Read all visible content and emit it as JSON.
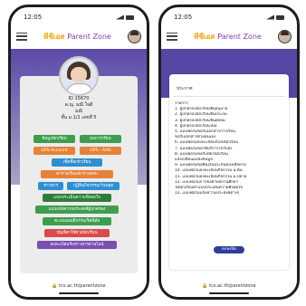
{
  "time_left": "12:05",
  "time_right": "12:05",
  "brand": {
    "logo": "ทีซีเอส",
    "title": "Parent Zone"
  },
  "profile": {
    "id_line": "ID 15670",
    "name": "ด.ญ. มณี ใจดี",
    "nickname": "มณี",
    "class": "ชั้น ม.1/1 เลขที่ 5"
  },
  "menu": {
    "btn1": "ข้อมูลนักเรียน",
    "btn2": "ผลการเรียน",
    "btn3": "GPS Account",
    "btn4": "GPS - AAA",
    "btn5": "เช็คชื่อเข้าเรียน",
    "btn6": "ตารางเรียน/ตารางสอบ",
    "btn7": "ข่าวสาร",
    "btn8": "ปฏิทินกิจกรรม/วันหยุด",
    "btn9": "แบบประเมินความพึงพอใจ",
    "btn10": "แบบแจ้งความประสงค์ผู้ปกครอง",
    "btn11": "คะแนนพฤติกรรม/จิตพิสัย",
    "btn12": "บัญชีค่าใช้จ่ายนักเรียน",
    "btn13": "ลงทะเบียนรับข่าวสารผ่านไลน์"
  },
  "footer_left": "🔒 tcs.ac.th/parentzone",
  "footer_right": "🔒 tcs.ac.th/parentzone",
  "dialog": {
    "title": "ประกาศ",
    "list_heading": "รายการ",
    "items": [
      "1. ผู้ปกครองนักเรียนชั้นอนุบาล",
      "2. ผู้ปกครองนักเรียนชั้นประถม",
      "3. ผู้ปกครองนักเรียนชั้นมัธยม",
      "4. ผู้ปกครองนักเรียนใหม่",
      "5. แบบฟอร์มขอรับเอกสารการเรียน",
      "   ขอรับเอกสารด้วยตนเอง",
      "6. แบบฟอร์มลงทะเบียนรับส่งนักเรียน",
      "7. แบบฟอร์มขอใช้บริการรถรับส่ง",
      "8. แบบฟอร์มขอรับบัตรนักเรียน",
      "   แจ้งเปลี่ยนแปลงข้อมูล",
      "9. แบบฟอร์มขอคืนเงินประกันของเสียหาย",
      "10. แบบฟอร์มลงทะเบียนกิจกรรม ม.ต้น",
      "11. แบบฟอร์มลงทะเบียนกิจกรรม ม.ปลาย",
      "12. แบบฟอร์มการขอย้ายสถานศึกษา",
      "   ให้นักเรียนทำแบบประเมินความพึงพอใจ",
      "13. แบบฟอร์มแจ้งความประสงค์ต่างๆ"
    ],
    "button": "ตกลงปิด"
  }
}
